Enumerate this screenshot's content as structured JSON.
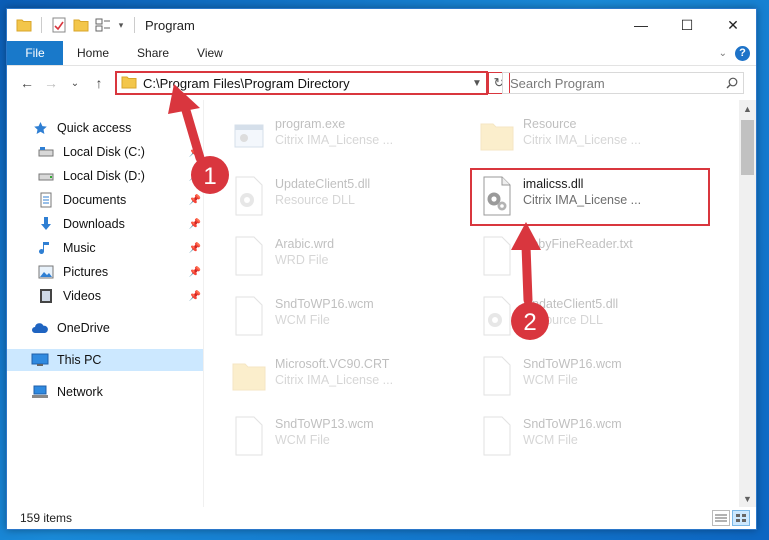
{
  "window": {
    "title": "Program",
    "controls": {
      "minimize": "—",
      "maximize": "☐",
      "close": "✕"
    }
  },
  "ribbon": {
    "tabs": [
      "File",
      "Home",
      "Share",
      "View"
    ]
  },
  "nav": {
    "address": "C:\\Program Files\\Program Directory",
    "search_placeholder": "Search Program"
  },
  "sidebar": {
    "items": [
      {
        "label": "Quick access",
        "icon": "star-icon",
        "pinned": false
      },
      {
        "label": "Local Disk (C:)",
        "icon": "drive-icon",
        "pinned": true
      },
      {
        "label": "Local Disk (D:)",
        "icon": "drive-icon",
        "pinned": true
      },
      {
        "label": "Documents",
        "icon": "documents-icon",
        "pinned": true
      },
      {
        "label": "Downloads",
        "icon": "download-icon",
        "pinned": true
      },
      {
        "label": "Music",
        "icon": "music-icon",
        "pinned": true
      },
      {
        "label": "Pictures",
        "icon": "pictures-icon",
        "pinned": true
      },
      {
        "label": "Videos",
        "icon": "videos-icon",
        "pinned": true
      },
      {
        "label": "OneDrive",
        "icon": "cloud-icon",
        "pinned": false
      },
      {
        "label": "This PC",
        "icon": "computer-icon",
        "pinned": false,
        "selected": true
      },
      {
        "label": "Network",
        "icon": "network-icon",
        "pinned": false
      }
    ]
  },
  "files": [
    {
      "name": "program.exe",
      "desc": "Citrix IMA_License ...",
      "icon": "exe-icon",
      "faded": true
    },
    {
      "name": "Resource",
      "desc": "Citrix IMA_License ...",
      "icon": "folder-icon",
      "faded": true
    },
    {
      "name": "UpdateClient5.dll",
      "desc": "Resource DLL",
      "icon": "dll-icon",
      "faded": true
    },
    {
      "name": "imalicss.dll",
      "desc": "Citrix IMA_License ...",
      "icon": "dll-icon",
      "faded": false
    },
    {
      "name": "Arabic.wrd",
      "desc": "WRD File",
      "icon": "file-icon",
      "faded": true
    },
    {
      "name": "AbbyFineReader.txt",
      "desc": "",
      "icon": "file-icon",
      "faded": true
    },
    {
      "name": "SndToWP16.wcm",
      "desc": "WCM File",
      "icon": "file-icon",
      "faded": true
    },
    {
      "name": "UpdateClient5.dll",
      "desc": "Resource DLL",
      "icon": "dll-icon",
      "faded": true
    },
    {
      "name": "Microsoft.VC90.CRT",
      "desc": "Citrix IMA_License ...",
      "icon": "folder-icon",
      "faded": true
    },
    {
      "name": "SndToWP16.wcm",
      "desc": "WCM File",
      "icon": "file-icon",
      "faded": true
    },
    {
      "name": "SndToWP13.wcm",
      "desc": "WCM File",
      "icon": "file-icon",
      "faded": true
    },
    {
      "name": "SndToWP16.wcm",
      "desc": "WCM File",
      "icon": "file-icon",
      "faded": true
    }
  ],
  "status": {
    "item_count": "159 items"
  },
  "annotations": {
    "step1": "1",
    "step2": "2",
    "color": "#d9363e"
  }
}
